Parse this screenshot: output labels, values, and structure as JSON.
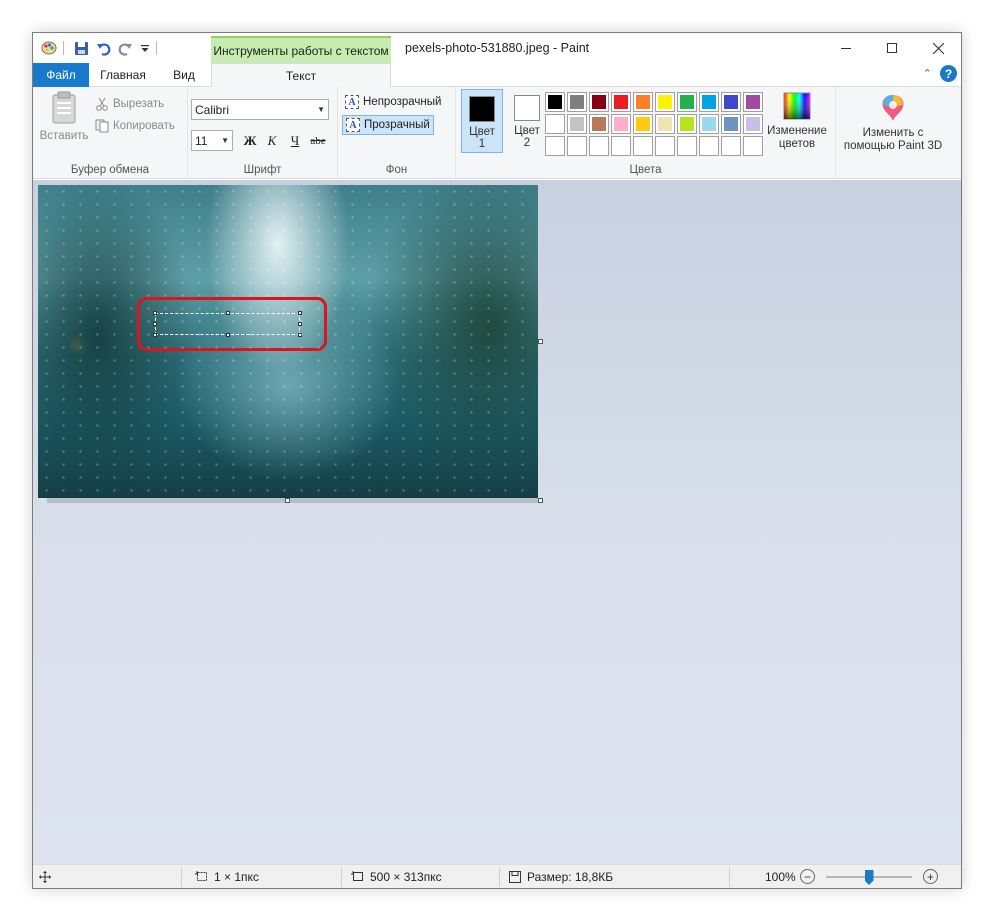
{
  "window": {
    "title": "pexels-photo-531880.jpeg - Paint",
    "context_tab": "Инструменты работы с текстом"
  },
  "tabs": {
    "file": "Файл",
    "home": "Главная",
    "view": "Вид",
    "text": "Текст"
  },
  "clipboard": {
    "paste": "Вставить",
    "cut": "Вырезать",
    "copy": "Копировать",
    "group": "Буфер обмена"
  },
  "font": {
    "family": "Calibri",
    "size": "11",
    "bold": "Ж",
    "italic": "К",
    "underline": "Ч",
    "strike": "abe",
    "group": "Шрифт"
  },
  "background": {
    "opaque": "Непрозрачный",
    "transparent": "Прозрачный",
    "group": "Фон"
  },
  "colors": {
    "color1_label": "Цвет",
    "color1_num": "1",
    "color2_label": "Цвет",
    "color2_num": "2",
    "color1": "#000000",
    "color2": "#ffffff",
    "edit_label1": "Изменение",
    "edit_label2": "цветов",
    "group": "Цвета",
    "palette": [
      "#000000",
      "#7f7f7f",
      "#880015",
      "#ed1c24",
      "#ff7f27",
      "#fff200",
      "#22b14c",
      "#00a2e8",
      "#3f48cc",
      "#a349a4",
      "#ffffff",
      "#c3c3c3",
      "#b97a57",
      "#ffaec9",
      "#ffc90e",
      "#efe4b0",
      "#b5e61d",
      "#99d9ea",
      "#7092be",
      "#c8bfe7",
      "#ffffff",
      "#ffffff",
      "#ffffff",
      "#ffffff",
      "#ffffff",
      "#ffffff",
      "#ffffff",
      "#ffffff",
      "#ffffff",
      "#ffffff"
    ]
  },
  "paint3d": {
    "label1": "Изменить с",
    "label2": "помощью Paint 3D"
  },
  "status": {
    "selection": "1 × 1пкс",
    "image_size": "500 × 313пкс",
    "file_size": "Размер: 18,8КБ",
    "zoom": "100%",
    "zoom_level": 0.5
  }
}
